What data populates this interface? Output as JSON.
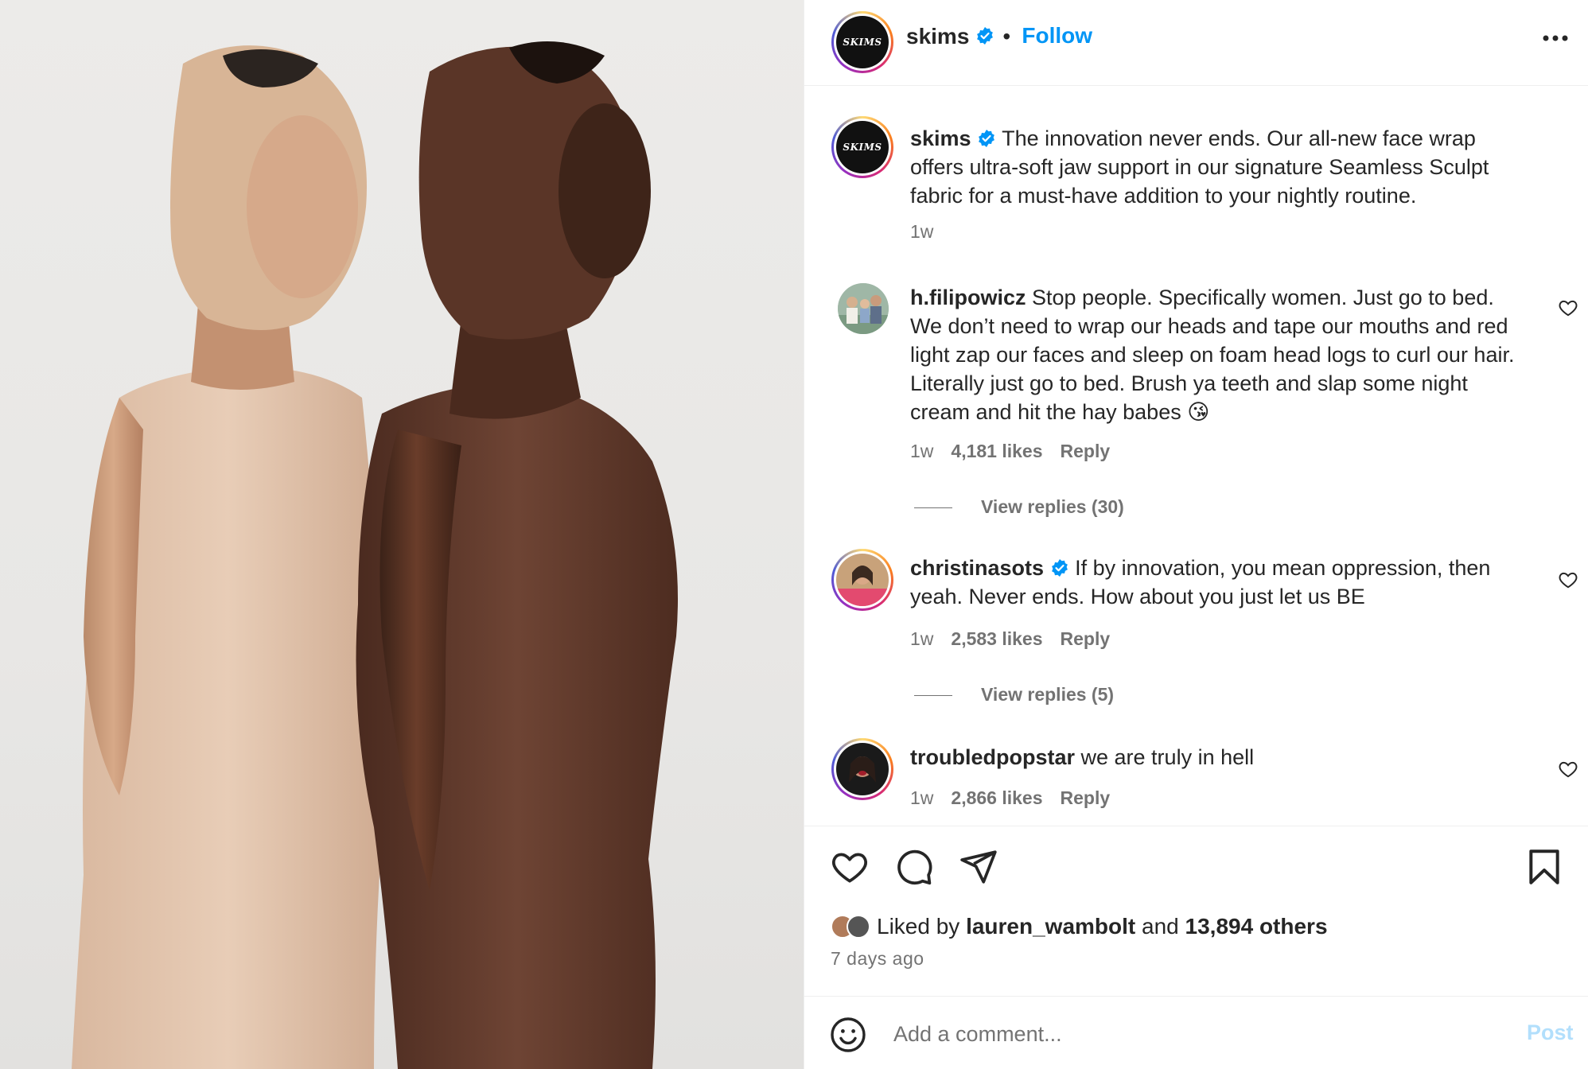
{
  "post": {
    "username": "skims",
    "verified": true,
    "follow_label": "Follow",
    "separator": "•",
    "logo_text": "SKIMS",
    "more_icon": "more-horizontal-icon"
  },
  "caption": {
    "username": "skims",
    "text": "The innovation never ends. Our all-new face wrap offers ultra-soft jaw support in our signature Seamless Sculpt fabric for a must-have addition to your nightly routine.",
    "time": "1w"
  },
  "comments": [
    {
      "username": "h.filipowicz",
      "verified": false,
      "text": "Stop people. Specifically women. Just go to bed. We don’t need to wrap our heads and tape our mouths and red light zap our faces and sleep on foam head logs to curl our hair. Literally just go to bed. Brush ya teeth and slap some night cream and hit the hay babes 😘",
      "time": "1w",
      "likes": "4,181 likes",
      "reply_label": "Reply",
      "view_replies": "View replies (30)"
    },
    {
      "username": "christinasots",
      "verified": true,
      "text": "If by innovation, you mean oppression, then yeah. Never ends. How about you just let us BE",
      "time": "1w",
      "likes": "2,583 likes",
      "reply_label": "Reply",
      "view_replies": "View replies (5)"
    },
    {
      "username": "troubledpopstar",
      "verified": false,
      "text": "we are truly in hell",
      "time": "1w",
      "likes": "2,866 likes",
      "reply_label": "Reply"
    }
  ],
  "actions": {
    "like_icon": "heart-icon",
    "comment_icon": "comment-icon",
    "share_icon": "share-icon",
    "save_icon": "bookmark-icon"
  },
  "likes": {
    "prefix": "Liked by",
    "user": "lauren_wambolt",
    "connector": "and",
    "others": "13,894 others"
  },
  "posted_ago": "7 days ago",
  "add_comment": {
    "placeholder": "Add a comment...",
    "post_label": "Post",
    "emoji_icon": "emoji-icon"
  },
  "colors": {
    "link_blue": "#0095f6",
    "post_disabled": "#b2dffc",
    "verified_blue": "#0095f6",
    "secondary_text": "#737373"
  }
}
